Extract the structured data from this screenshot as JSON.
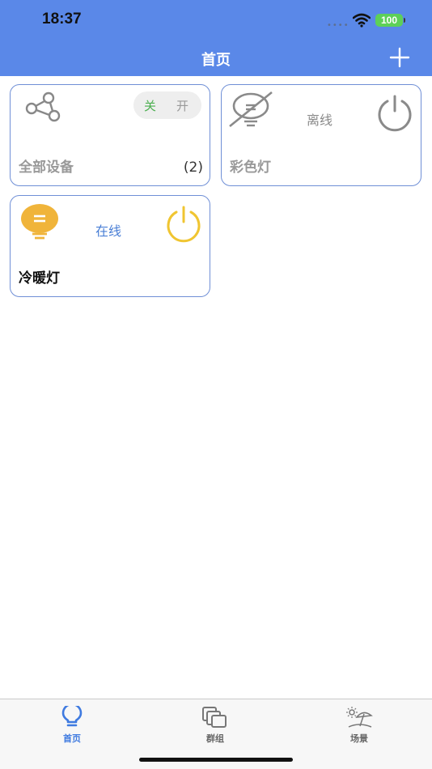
{
  "status_bar": {
    "time": "18:37",
    "battery": "100",
    "signal": "••••"
  },
  "nav": {
    "title": "首页"
  },
  "cards": {
    "all": {
      "title": "全部设备",
      "count": "(2)",
      "toggle_off": "关",
      "toggle_on": "开"
    },
    "color_light": {
      "title": "彩色灯",
      "status": "离线"
    },
    "warm_light": {
      "title": "冷暖灯",
      "status": "在线"
    }
  },
  "tabbar": {
    "home": "首页",
    "groups": "群组",
    "scenes": "场景"
  },
  "colors": {
    "accent": "#5a88e8",
    "online": "#4a7fd6",
    "offline": "#8a8a8a",
    "lamp_on": "#f0b43a",
    "toggle_off_green": "#4caf50"
  }
}
